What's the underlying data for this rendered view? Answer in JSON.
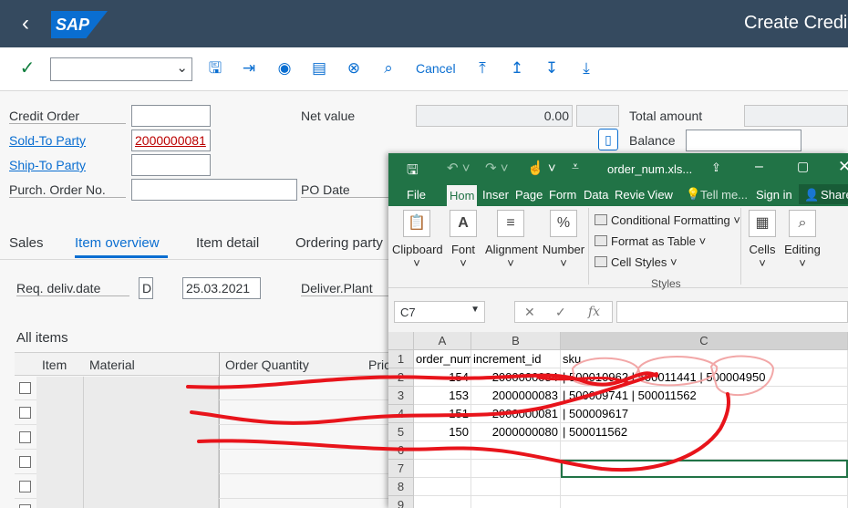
{
  "shell": {
    "title": "Create Credi",
    "logo": "SAP"
  },
  "toolbar": {
    "cancel_label": "Cancel",
    "icons": [
      "check-icon",
      "save-icon",
      "fetch-icon",
      "display-icon",
      "document-icon",
      "close-circle-icon",
      "search-icon",
      "upload-icon",
      "first-icon",
      "previous-icon",
      "next-icon"
    ]
  },
  "header_fields": {
    "credit_order_label": "Credit  Order",
    "sold_to_label": "Sold-To Party",
    "sold_to_value": "2000000081",
    "ship_to_label": "Ship-To Party",
    "purch_order_label": "Purch. Order No.",
    "po_date_label": "PO Date",
    "net_value_label": "Net value",
    "net_value": "0.00",
    "total_amount_label": "Total amount",
    "balance_label": "Balance"
  },
  "tabs": [
    "Sales",
    "Item overview",
    "Item detail",
    "Ordering party"
  ],
  "active_tab": "Item overview",
  "item_overview": {
    "req_deliv_label": "Req. deliv.date",
    "req_deliv_unit": "D",
    "req_deliv_date": "25.03.2021",
    "deliver_plant_label": "Deliver.Plant",
    "all_items_label": "All items",
    "columns": [
      "Item",
      "Material",
      "Order Quantity",
      "Pric"
    ],
    "row_count": 6
  },
  "excel": {
    "filename": "order_num.xls...",
    "ribbon_tabs": [
      "File",
      "Hom",
      "Inser",
      "Page",
      "Form",
      "Data",
      "Revie",
      "View"
    ],
    "active_ribbon_tab": "Hom",
    "tell_me": "Tell me...",
    "sign_in": "Sign in",
    "share": "Share",
    "groups": {
      "clipboard": "Clipboard",
      "font": "Font",
      "alignment": "Alignment",
      "number": "Number",
      "conditional_formatting": "Conditional Formatting",
      "format_as_table": "Format as Table",
      "cell_styles": "Cell Styles",
      "styles": "Styles",
      "cells": "Cells",
      "editing": "Editing"
    },
    "name_box": "C7",
    "column_headers": [
      "A",
      "B",
      "C"
    ],
    "rows": [
      {
        "n": "1",
        "a": "order_num",
        "b": "increment_id",
        "c": "sku"
      },
      {
        "n": "2",
        "a": "154",
        "b": "2000000084",
        "c": "| 500010962 | 500011441 | 500004950"
      },
      {
        "n": "3",
        "a": "153",
        "b": "2000000083",
        "c": "| 500009741 | 500011562"
      },
      {
        "n": "4",
        "a": "151",
        "b": "2000000081",
        "c": "| 500009617"
      },
      {
        "n": "5",
        "a": "150",
        "b": "2000000080",
        "c": "| 500011562"
      },
      {
        "n": "6",
        "a": "",
        "b": "",
        "c": ""
      },
      {
        "n": "7",
        "a": "",
        "b": "",
        "c": ""
      },
      {
        "n": "8",
        "a": "",
        "b": "",
        "c": ""
      },
      {
        "n": "9",
        "a": "",
        "b": "",
        "c": ""
      }
    ]
  },
  "colors": {
    "shell": "#354a5f",
    "sap_blue": "#0a6ed1",
    "excel_green": "#217346",
    "annotation_red": "#e8141b",
    "annotation_pink": "#f2a7a7"
  }
}
